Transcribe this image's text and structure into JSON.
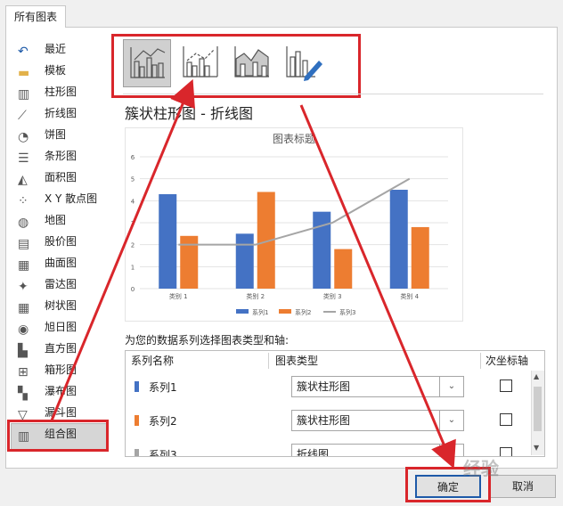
{
  "tabs": {
    "all_charts": "所有图表"
  },
  "sidebar": {
    "items": [
      {
        "label": "最近",
        "icon": "recent-icon"
      },
      {
        "label": "模板",
        "icon": "folder-icon"
      },
      {
        "label": "柱形图",
        "icon": "column-chart-icon"
      },
      {
        "label": "折线图",
        "icon": "line-chart-icon"
      },
      {
        "label": "饼图",
        "icon": "pie-chart-icon"
      },
      {
        "label": "条形图",
        "icon": "bar-chart-icon"
      },
      {
        "label": "面积图",
        "icon": "area-chart-icon"
      },
      {
        "label": "X Y 散点图",
        "icon": "scatter-chart-icon"
      },
      {
        "label": "地图",
        "icon": "map-chart-icon"
      },
      {
        "label": "股价图",
        "icon": "stock-chart-icon"
      },
      {
        "label": "曲面图",
        "icon": "surface-chart-icon"
      },
      {
        "label": "雷达图",
        "icon": "radar-chart-icon"
      },
      {
        "label": "树状图",
        "icon": "treemap-chart-icon"
      },
      {
        "label": "旭日图",
        "icon": "sunburst-chart-icon"
      },
      {
        "label": "直方图",
        "icon": "histogram-chart-icon"
      },
      {
        "label": "箱形图",
        "icon": "box-whisker-chart-icon"
      },
      {
        "label": "瀑布图",
        "icon": "waterfall-chart-icon"
      },
      {
        "label": "漏斗图",
        "icon": "funnel-chart-icon"
      },
      {
        "label": "组合图",
        "icon": "combo-chart-icon",
        "selected": true
      }
    ]
  },
  "main": {
    "heading": "簇状柱形图 - 折线图",
    "series_prompt": "为您的数据系列选择图表类型和轴:",
    "grid_headers": {
      "name": "系列名称",
      "type": "图表类型",
      "secondary": "次坐标轴"
    },
    "rows": [
      {
        "name": "系列1",
        "color": "#4472c4",
        "type": "簇状柱形图",
        "secondary": false
      },
      {
        "name": "系列2",
        "color": "#ed7d31",
        "type": "簇状柱形图",
        "secondary": false
      },
      {
        "name": "系列3",
        "color": "#a5a5a5",
        "type": "折线图",
        "secondary": false
      }
    ]
  },
  "buttons": {
    "ok": "确定",
    "cancel": "取消"
  },
  "watermark": "经验",
  "chart_data": {
    "type": "bar",
    "title": "图表标题",
    "categories": [
      "类别 1",
      "类别 2",
      "类别 3",
      "类别 4"
    ],
    "series": [
      {
        "name": "系列1",
        "type": "bar",
        "color": "#4472c4",
        "values": [
          4.3,
          2.5,
          3.5,
          4.5
        ]
      },
      {
        "name": "系列2",
        "type": "bar",
        "color": "#ed7d31",
        "values": [
          2.4,
          4.4,
          1.8,
          2.8
        ]
      },
      {
        "name": "系列3",
        "type": "line",
        "color": "#a5a5a5",
        "values": [
          2,
          2,
          3,
          5
        ]
      }
    ],
    "yticks": [
      0,
      1,
      2,
      3,
      4,
      5,
      6
    ],
    "ylim": [
      0,
      6
    ],
    "legend": "bottom"
  }
}
